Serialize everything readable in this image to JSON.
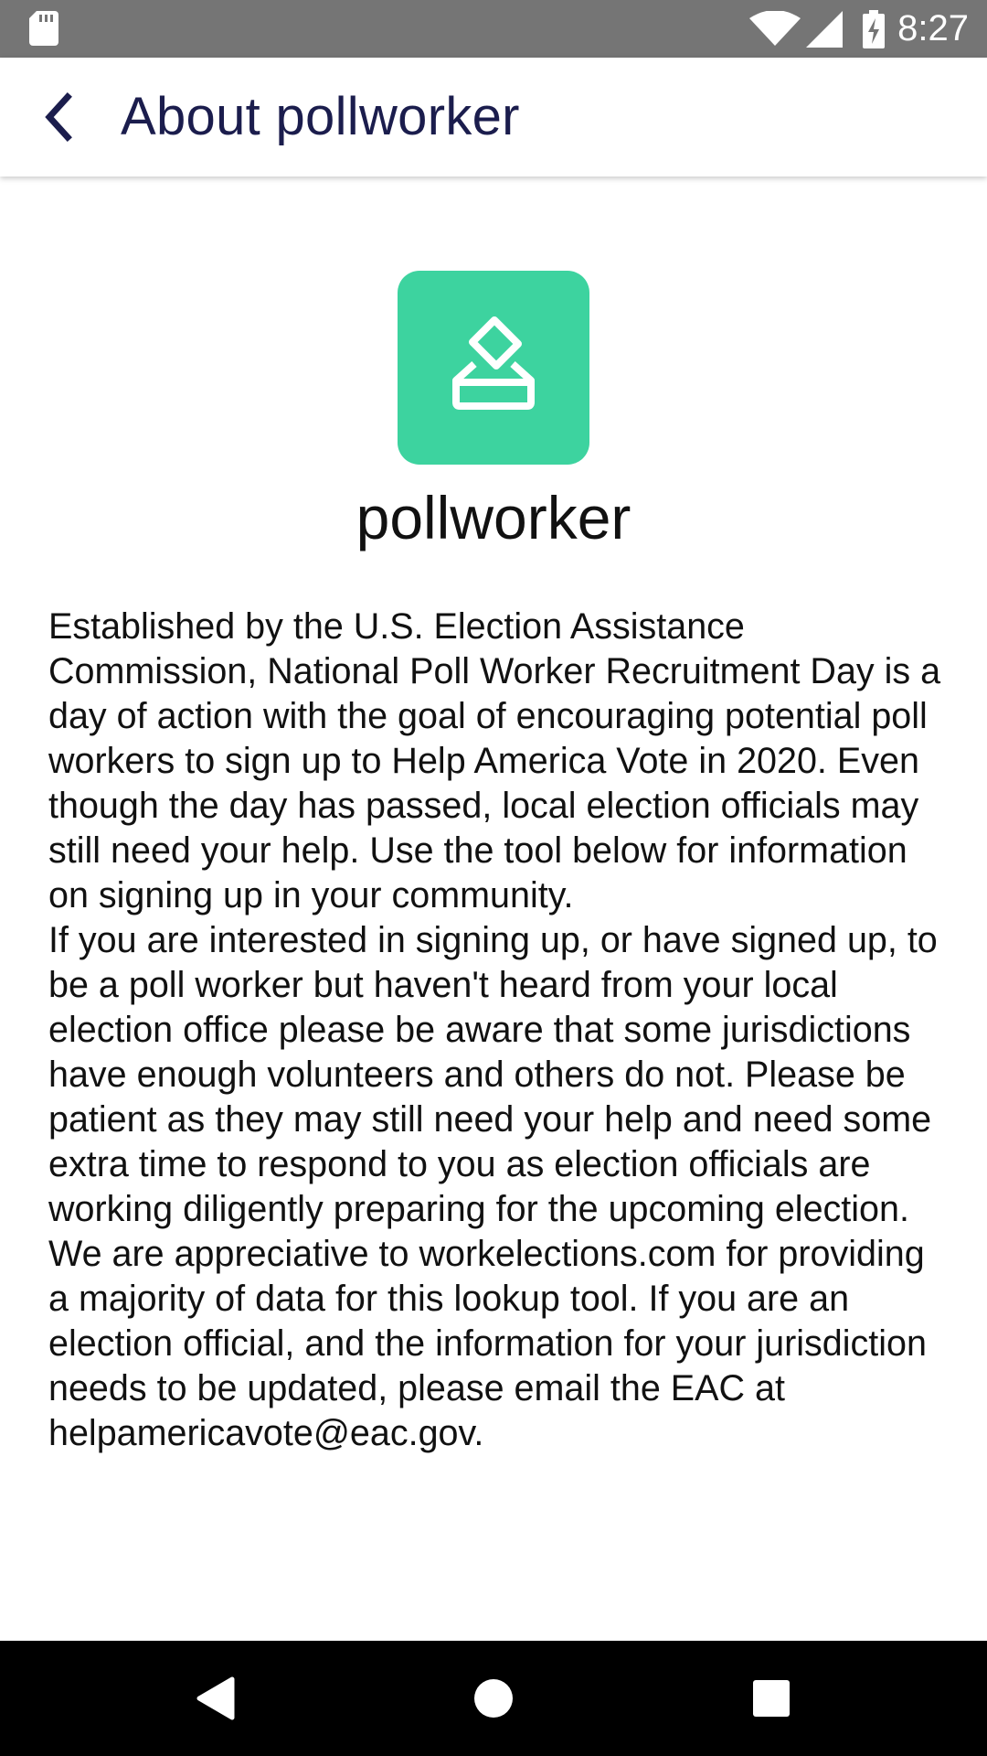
{
  "status_bar": {
    "time": "8:27",
    "icons": [
      "sd-card-icon",
      "wifi-icon",
      "cellular-signal-icon",
      "battery-charging-icon"
    ]
  },
  "app_bar": {
    "title": "About pollworker",
    "back_icon": "back-arrow-icon"
  },
  "content": {
    "logo_icon": "ballot-box-icon",
    "logo_color": "#3dd39f",
    "app_name": "pollworker",
    "paragraphs": [
      "Established by the U.S. Election Assistance Commission, National Poll Worker Recruitment Day is a day of action with the goal of encouraging potential poll workers to sign up to Help America Vote in 2020. Even though the day has passed, local election officials may still need your help. Use the tool below for information on signing up in your community.",
      "If you are interested in signing up, or have signed up, to be a poll worker but haven't heard from your local election office please be aware that some jurisdictions have enough volunteers and others do not. Please be patient as they may still need your help and need some extra time to respond to you as election officials are working diligently preparing for the upcoming election.",
      "We are appreciative to workelections.com for providing a majority of data for this lookup tool. If you are an election official, and the information for your jurisdiction needs to be updated, please email the EAC at helpamericavote@eac.gov."
    ]
  },
  "nav_bar": {
    "buttons": [
      "back-triangle-icon",
      "home-circle-icon",
      "recents-square-icon"
    ]
  },
  "colors": {
    "status_bar_bg": "#757575",
    "title_text": "#1b1d4d",
    "body_text": "#111111",
    "nav_bar_bg": "#000000"
  }
}
